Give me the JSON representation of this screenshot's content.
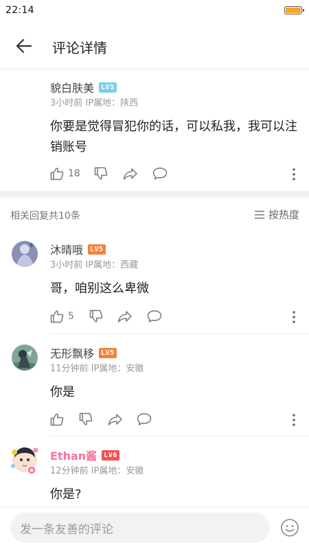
{
  "status_bar": {
    "time": "22:14",
    "battery_level": 1.0
  },
  "header": {
    "title": "评论详情"
  },
  "main_comment": {
    "username": "貌白肤美",
    "level": "LV3",
    "meta": "3小时前  IP属地：陕西",
    "text": "你要是觉得冒犯你的话，可以私我，我可以注销账号",
    "likes": "18"
  },
  "replies": {
    "count_label": "相关回复共10条",
    "sort_label": "按热度"
  },
  "reply_list": [
    {
      "username": "沐晴哦",
      "level": "LV5",
      "meta": "3小时前  IP属地：西藏",
      "text": "哥，咱别这么卑微",
      "likes": "5"
    },
    {
      "username": "无形飘移",
      "level": "LV5",
      "meta": "11分钟前  IP属地：安徽",
      "text": "你是",
      "likes": ""
    },
    {
      "username": "Ethan酱",
      "level": "LV6",
      "meta": "12分钟前  IP属地：安徽",
      "text": "你是?",
      "likes": ""
    }
  ],
  "input": {
    "placeholder": "发一条友善的评论"
  },
  "colors": {
    "lv3": "#7ad0ee",
    "lv5": "#fb7f3b",
    "lv6": "#f5504f",
    "vip_name": "#fb7299",
    "battery": "#f5a623"
  }
}
